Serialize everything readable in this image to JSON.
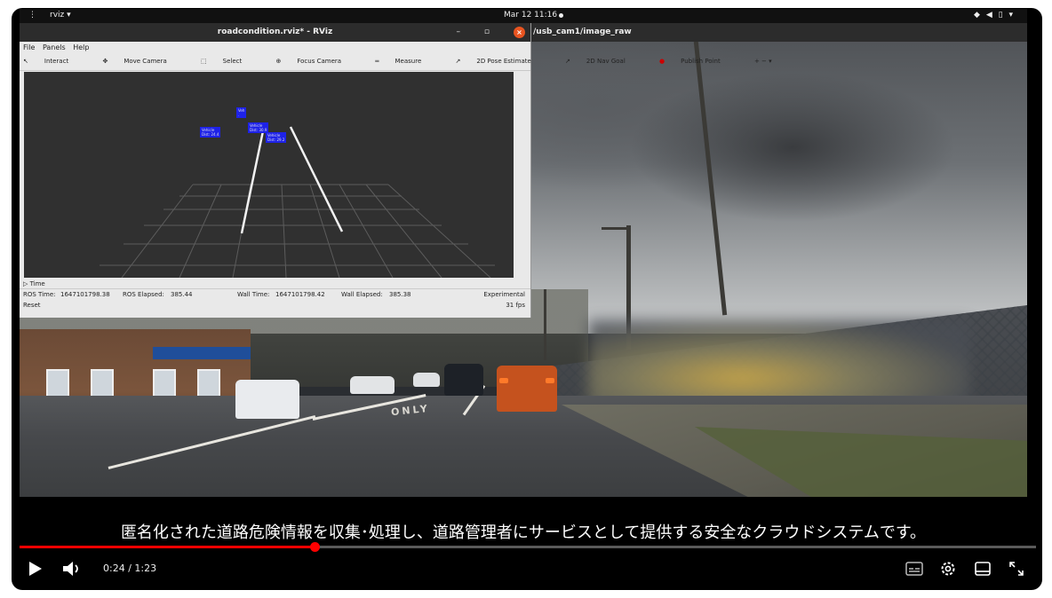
{
  "topbar": {
    "activities": "⋮",
    "app_label": "rviz ▾",
    "clock": "Mar 12  11:16",
    "tray_icons": [
      "wifi-icon",
      "volume-icon",
      "battery-icon",
      "power-menu-icon"
    ]
  },
  "rviz": {
    "title": "roadcondition.rviz* - RViz",
    "window_controls": "– ▫",
    "menu": [
      "File",
      "Panels",
      "Help"
    ],
    "tools": [
      "Interact",
      "Move Camera",
      "Select",
      "Focus Camera",
      "Measure",
      "2D Pose Estimate",
      "2D Nav Goal",
      "Publish Point"
    ],
    "markers": [
      {
        "line1": "Vehicle",
        "line2": "Dist: 24.4"
      },
      {
        "line1": "Vehicle",
        "line2": "Dist: 29.2"
      },
      {
        "line1": "Vehicle",
        "line2": "Dist: 30.9"
      },
      {
        "line1": "Veh",
        "line2": "."
      }
    ],
    "time_panel": {
      "header": "Time",
      "ros_time_label": "ROS Time:",
      "ros_time": "1647101798.38",
      "ros_elapsed_label": "ROS Elapsed:",
      "ros_elapsed": "385.44",
      "wall_time_label": "Wall Time:",
      "wall_time": "1647101798.42",
      "wall_elapsed_label": "Wall Elapsed:",
      "wall_elapsed": "385.38",
      "experimental": "Experimental",
      "reset": "Reset",
      "fps": "31 fps"
    }
  },
  "camera_window": {
    "title": "/usb_cam1/image_raw"
  },
  "scene": {
    "road_marking": "ONLY"
  },
  "subtitle": "匿名化された道路危険情報を収集･処理し、道路管理者にサービスとして提供する安全なクラウドシステムです。",
  "player": {
    "current_time": "0:24",
    "duration": "1:23",
    "time_display": "0:24 / 1:23",
    "progress_fraction": 0.29,
    "accent_color": "#ff0000"
  }
}
